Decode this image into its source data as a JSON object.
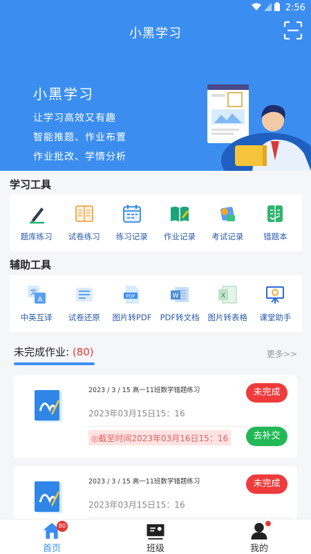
{
  "status_bar": {
    "time": "2:56"
  },
  "header": {
    "title": "小黑学习",
    "scan_icon": "scan-icon"
  },
  "hero": {
    "title": "小黑学习",
    "lines": [
      "让学习高效又有趣",
      "智能推题、作业布置",
      "作业批改、学情分析"
    ]
  },
  "study_tools": {
    "title": "学习工具",
    "items": [
      {
        "label": "题库练习",
        "icon": "pen-book-icon"
      },
      {
        "label": "试卷练习",
        "icon": "paper-icon"
      },
      {
        "label": "练习记录",
        "icon": "calendar-icon"
      },
      {
        "label": "作业记录",
        "icon": "open-book-icon"
      },
      {
        "label": "考试记录",
        "icon": "exam-icon"
      },
      {
        "label": "错题本",
        "icon": "notebook-icon"
      }
    ]
  },
  "aux_tools": {
    "title": "辅助工具",
    "items": [
      {
        "label": "中英互译",
        "icon": "translate-icon"
      },
      {
        "label": "试卷还原",
        "icon": "restore-icon"
      },
      {
        "label": "图片转PDF",
        "icon": "pdf-icon"
      },
      {
        "label": "PDF转文档",
        "icon": "word-icon"
      },
      {
        "label": "图片转表格",
        "icon": "excel-icon"
      },
      {
        "label": "课堂助手",
        "icon": "board-icon"
      }
    ]
  },
  "homework": {
    "title": "未完成作业:",
    "count": "(80)",
    "more": "更多>>",
    "cards": [
      {
        "title": "2023 / 3 / 15 高一11班数学错题练习",
        "date": "2023年03月15日15：16",
        "deadline": "◎截至时间2023年03月16日15：16",
        "status": "未完成",
        "action": "去补交"
      },
      {
        "title": "2023 / 3 / 15 高一11班数学错题练习",
        "date": "2023年03月15日15：16",
        "status": "未完成"
      }
    ]
  },
  "bottom_nav": {
    "items": [
      {
        "label": "首页",
        "badge": "80"
      },
      {
        "label": "班级"
      },
      {
        "label": "我的"
      }
    ]
  },
  "colors": {
    "primary": "#3b8ef0",
    "danger": "#ef3b3b",
    "success": "#22b857"
  }
}
